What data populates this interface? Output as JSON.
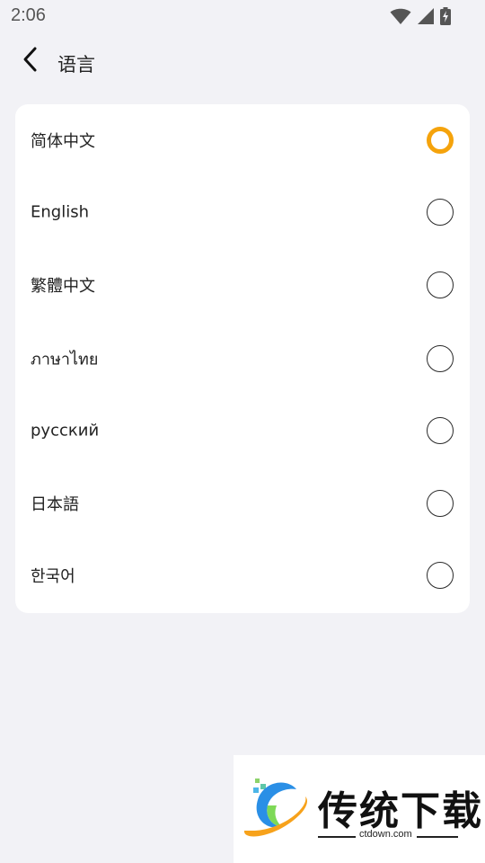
{
  "status_bar": {
    "time": "2:06",
    "icons": [
      "wifi-icon",
      "cellular-signal-icon",
      "battery-charging-icon"
    ]
  },
  "app_bar": {
    "back_icon": "chevron-left-icon",
    "title": "语言"
  },
  "languages": {
    "items": [
      {
        "label": "简体中文",
        "selected": true
      },
      {
        "label": "English",
        "selected": false
      },
      {
        "label": "繁體中文",
        "selected": false
      },
      {
        "label": "ภาษาไทย",
        "selected": false
      },
      {
        "label": "русский",
        "selected": false
      },
      {
        "label": "日本語",
        "selected": false
      },
      {
        "label": "한국어",
        "selected": false
      }
    ]
  },
  "watermark": {
    "brand": "传统下载",
    "domain": "ctdown.com"
  },
  "colors": {
    "background": "#f2f2f6",
    "card": "#ffffff",
    "accent": "#f5a30c",
    "radio_border": "#2a2a2a"
  }
}
